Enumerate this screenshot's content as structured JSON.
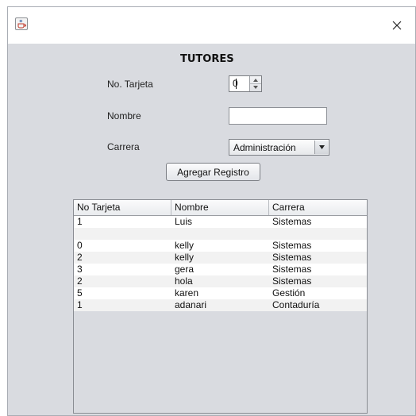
{
  "window": {
    "close_symbol": "✕",
    "app_icon": "java-cup-icon"
  },
  "form": {
    "heading": "TUTORES",
    "tarjeta_label": "No. Tarjeta",
    "tarjeta_value": "0",
    "nombre_label": "Nombre",
    "nombre_value": "",
    "carrera_label": "Carrera",
    "carrera_selected": "Administración",
    "add_button": "Agregar Registro"
  },
  "table": {
    "columns": [
      "No Tarjeta",
      "Nombre",
      "Carrera"
    ],
    "rows": [
      [
        "1",
        "Luis",
        "Sistemas"
      ],
      [
        "",
        "",
        ""
      ],
      [
        "0",
        "kelly",
        "Sistemas"
      ],
      [
        "2",
        "kelly",
        "Sistemas"
      ],
      [
        "3",
        "gera",
        "Sistemas"
      ],
      [
        "2",
        "hola",
        "Sistemas"
      ],
      [
        "5",
        "karen",
        "Gestión"
      ],
      [
        "1",
        "adanari",
        "Contaduría"
      ]
    ]
  }
}
